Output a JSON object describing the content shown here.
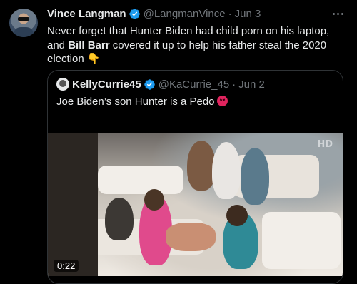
{
  "tweet": {
    "author_name": "Vince Langman",
    "handle": "@LangmanVince",
    "date": "Jun 3",
    "separator": "·",
    "text_part1": "Never forget that Hunter Biden had child porn on his laptop, and ",
    "text_bold": "Bill Barr",
    "text_part2": " covered it up to help his father steal the 2020 election ",
    "text_emoji": "👇",
    "more_icon": "more-icon"
  },
  "quote": {
    "author_name": "KellyCurrie45",
    "handle": "@KaCurrie_45",
    "date": "Jun 2",
    "separator": "·",
    "text": "Joe Biden’s son Hunter is a Pedo"
  },
  "video": {
    "watermark": "HD",
    "duration": "0:22"
  },
  "colors": {
    "background": "#000000",
    "text": "#e7e9ea",
    "muted": "#71767b",
    "border": "#2f3336",
    "verified": "#1d9bf0"
  }
}
